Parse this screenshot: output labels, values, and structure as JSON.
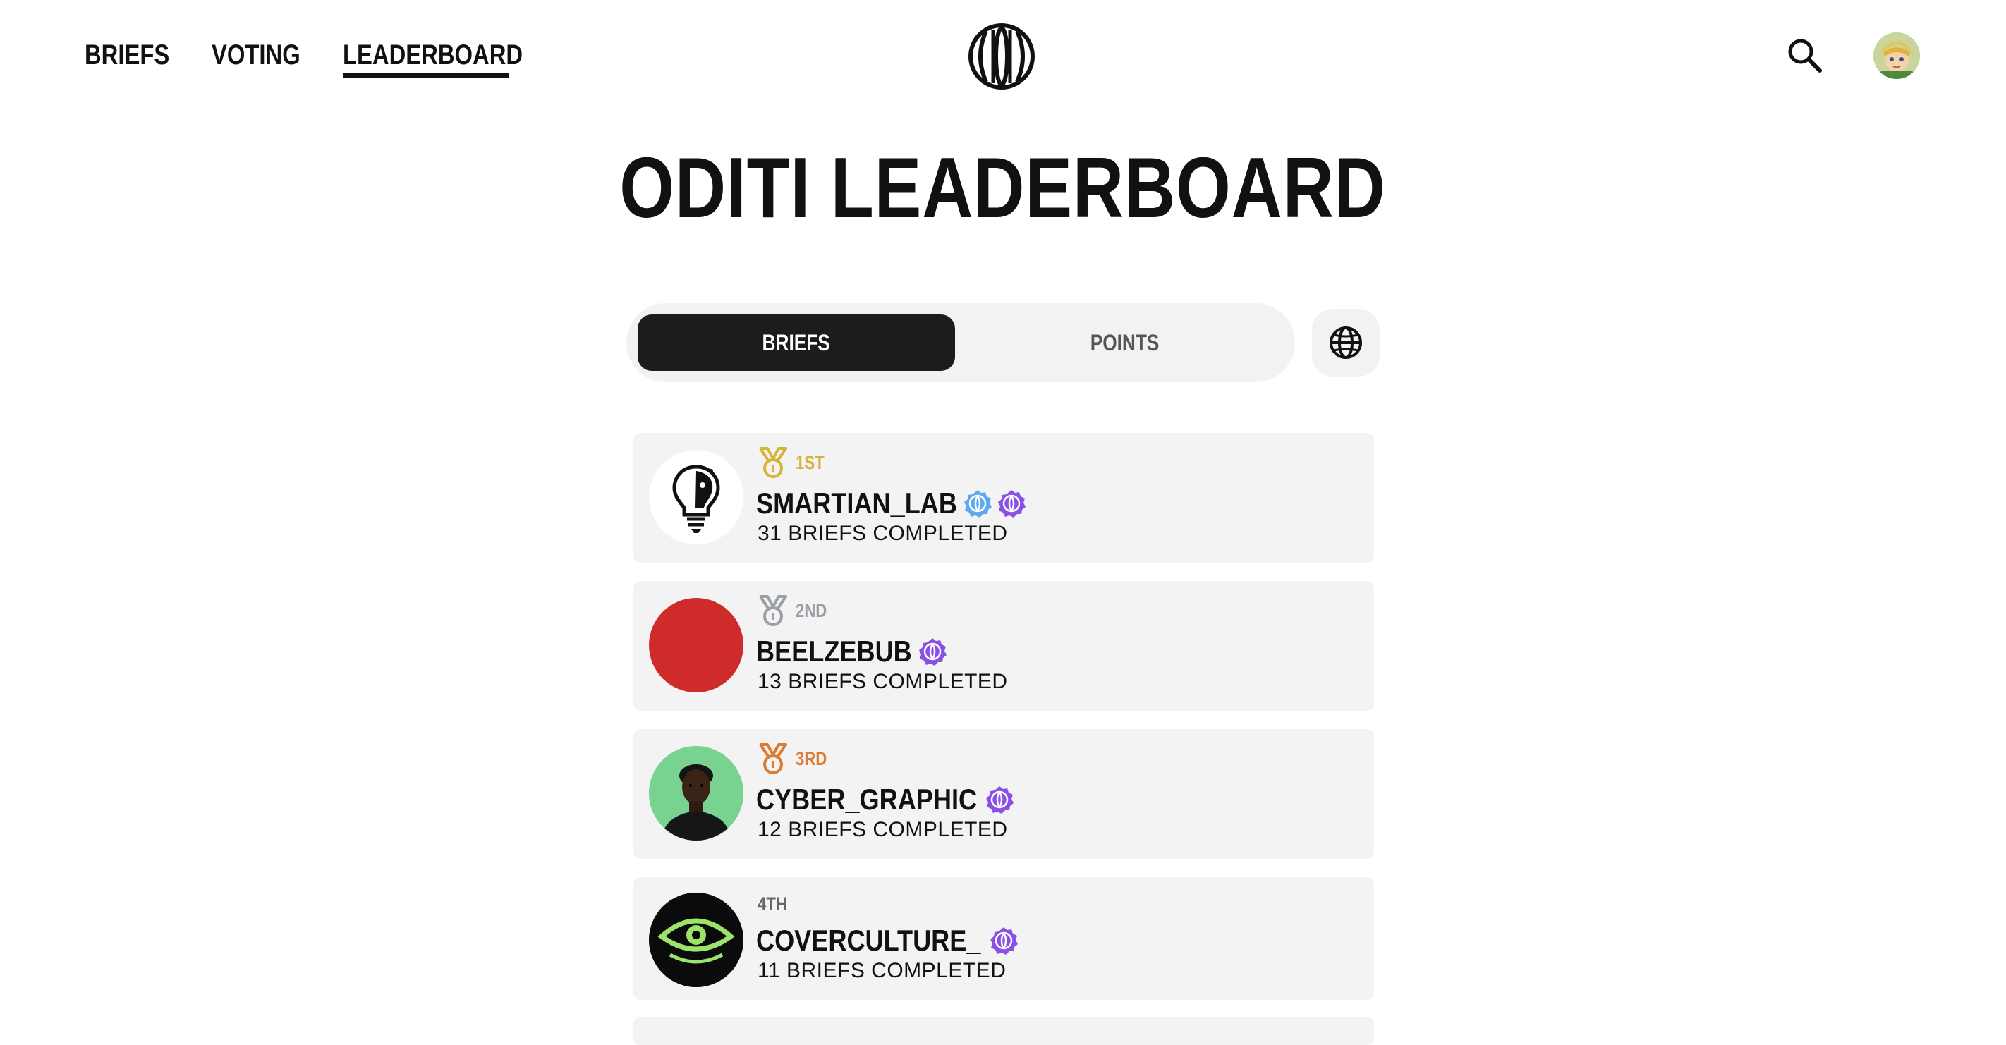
{
  "nav": {
    "items": [
      {
        "label": "BRIEFS",
        "active": false
      },
      {
        "label": "VOTING",
        "active": false
      },
      {
        "label": "LEADERBOARD",
        "active": true
      }
    ]
  },
  "header": {
    "logo_icon": "oditi-logo-icon",
    "search_icon": "search-icon",
    "avatar_icon": "user-avatar"
  },
  "page": {
    "title": "ODITI LEADERBOARD"
  },
  "tabs": {
    "briefs_label": "BRIEFS",
    "points_label": "POINTS",
    "active": "BRIEFS",
    "globe_icon": "globe-icon"
  },
  "colors": {
    "gold": "#d6b339",
    "silver": "#9a9fa6",
    "bronze": "#de7b32",
    "badge_blue": "#5ea8ef",
    "badge_purple": "#8a4fe6",
    "active_tab": "#1c1c1c",
    "card_bg": "#f3f3f3"
  },
  "leaderboard": [
    {
      "rank": "1ST",
      "medal": "gold",
      "username": "SMARTIAN_LAB",
      "badges": [
        "blue-badge",
        "purple-badge"
      ],
      "completed": "31 BRIEFS COMPLETED",
      "avatar": "lightbulb-head-avatar"
    },
    {
      "rank": "2ND",
      "medal": "silver",
      "username": "BEELZEBUB",
      "badges": [
        "purple-badge"
      ],
      "completed": "13 BRIEFS COMPLETED",
      "avatar": "red-circle-avatar"
    },
    {
      "rank": "3RD",
      "medal": "bronze",
      "username": "CYBER_GRAPHIC",
      "badges": [
        "purple-badge"
      ],
      "completed": "12 BRIEFS COMPLETED",
      "avatar": "portrait-avatar"
    },
    {
      "rank": "4TH",
      "medal": "none",
      "username": "COVERCULTURE_",
      "badges": [
        "purple-badge"
      ],
      "completed": "11 BRIEFS COMPLETED",
      "avatar": "green-eye-avatar"
    }
  ]
}
